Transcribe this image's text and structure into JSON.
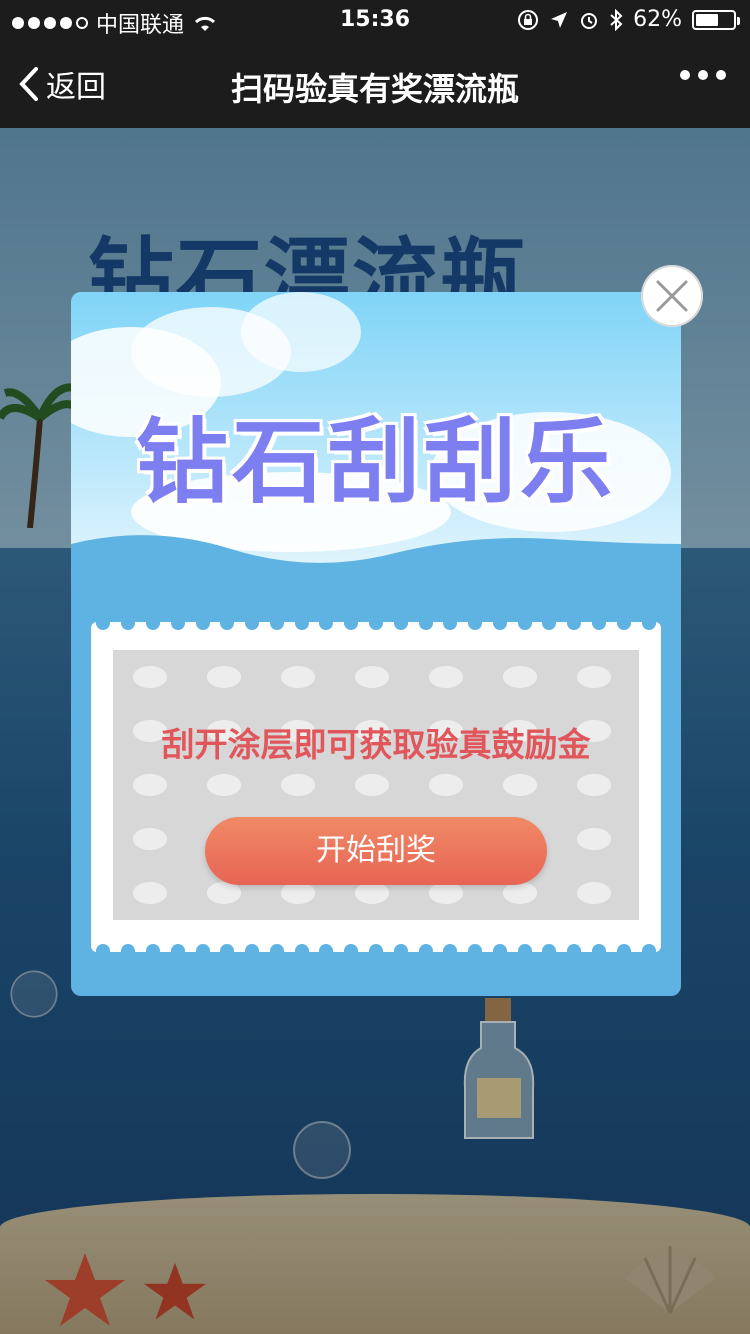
{
  "status_bar": {
    "carrier": "中国联通",
    "time": "15:36",
    "battery": "62%",
    "battery_level": 0.62
  },
  "nav": {
    "back_label": "返回",
    "title": "扫码验真有奖漂流瓶"
  },
  "background": {
    "title": "钻石漂流瓶"
  },
  "modal": {
    "title": "钻石刮刮乐",
    "scratch_hint": "刮开涂层即可获取验真鼓励金",
    "start_button": "开始刮奖"
  },
  "colors": {
    "accent": "#7d7ff0",
    "button": "#e86454",
    "hint": "#e0565a",
    "modal_bg": "#5fb3e2"
  }
}
